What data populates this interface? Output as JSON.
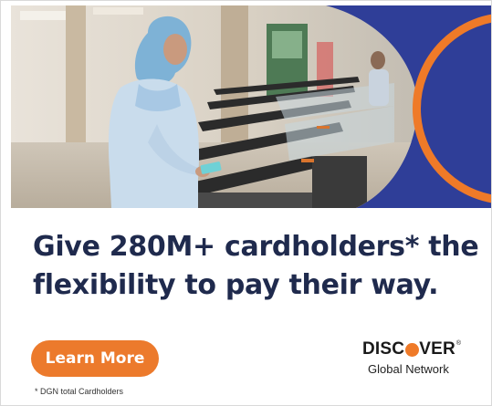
{
  "headline": {
    "line1": "Give 280M+ cardholders* the",
    "line2": "flexibility to pay their way."
  },
  "cta": {
    "label": "Learn More"
  },
  "footnote": "* DGN total Cardholders",
  "logo": {
    "word_start": "DISC",
    "word_end": "VER",
    "trademark": "®",
    "subtitle": "Global Network"
  },
  "colors": {
    "navy": "#2f3e98",
    "orange": "#ef7a28",
    "headline": "#1f2a4d"
  }
}
